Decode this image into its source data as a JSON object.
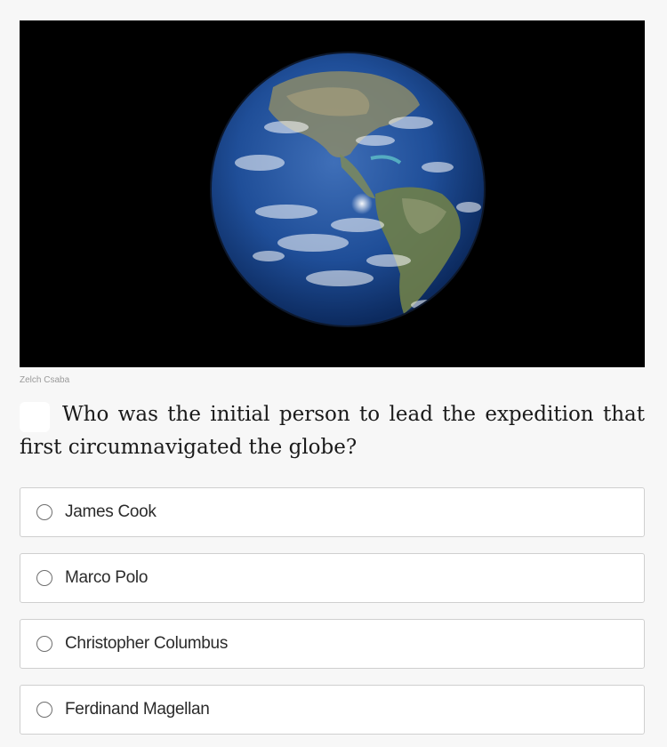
{
  "image": {
    "credit": "Zelch Csaba",
    "alt": "earth-globe-image"
  },
  "question": {
    "number": "",
    "text": "Who was the initial person to lead the expedition that first circumnavigated the globe?"
  },
  "answers": [
    {
      "label": "James Cook"
    },
    {
      "label": "Marco Polo"
    },
    {
      "label": "Christopher Columbus"
    },
    {
      "label": "Ferdinand Magellan"
    }
  ]
}
